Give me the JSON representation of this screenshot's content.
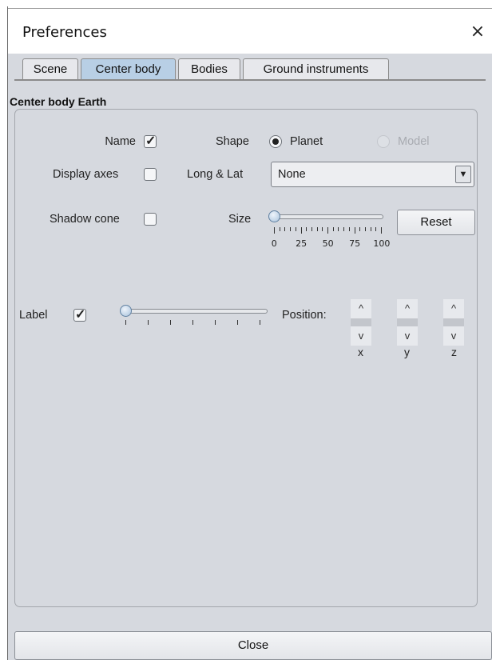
{
  "window": {
    "title": "Preferences",
    "close_glyph": "×"
  },
  "tabs": [
    {
      "label": "Scene",
      "active": false
    },
    {
      "label": "Center body",
      "active": true
    },
    {
      "label": "Bodies",
      "active": false
    },
    {
      "label": "Ground instruments",
      "active": false
    }
  ],
  "group": {
    "title": "Center body Earth"
  },
  "name_row": {
    "label": "Name",
    "checked": true,
    "check_glyph": "✓"
  },
  "shape": {
    "label": "Shape",
    "options": [
      {
        "label": "Planet",
        "selected": true
      },
      {
        "label": "Model",
        "selected": false,
        "disabled": true
      }
    ]
  },
  "display_axes": {
    "label": "Display axes",
    "checked": false
  },
  "long_lat": {
    "label": "Long & Lat",
    "value": "None",
    "arrow_glyph": "▼"
  },
  "shadow_cone": {
    "label": "Shadow cone",
    "checked": false
  },
  "size": {
    "label": "Size",
    "value": 0,
    "min": 0,
    "max": 100,
    "tick_labels": [
      "0",
      "25",
      "50",
      "75",
      "100"
    ]
  },
  "reset_button": {
    "label": "Reset"
  },
  "label_row": {
    "label": "Label",
    "checked": true,
    "check_glyph": "✓",
    "slider_value": 0
  },
  "position": {
    "label": "Position:",
    "axes": [
      "x",
      "y",
      "z"
    ],
    "up_glyph": "^",
    "down_glyph": "v"
  },
  "close_button": {
    "label": "Close"
  },
  "icons": {
    "close": "close-icon",
    "check": "check-icon",
    "dropdown": "chevron-down-icon"
  }
}
